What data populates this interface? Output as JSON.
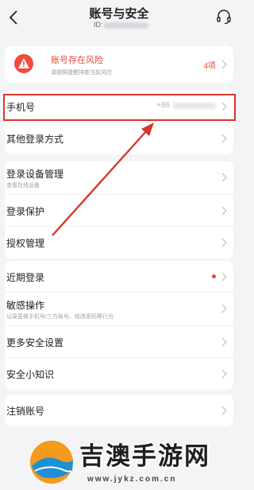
{
  "header": {
    "title": "账号与安全",
    "id_label": "ID:"
  },
  "risk_card": {
    "title": "账号存在风险",
    "subtitle": "请按照提醒排查当前风险",
    "count": "4项"
  },
  "phone_row": {
    "label": "手机号",
    "value": "+86"
  },
  "other_login": {
    "label": "其他登录方式"
  },
  "device_group": [
    {
      "label": "登录设备管理",
      "sub": "查看在线设备"
    },
    {
      "label": "登录保护"
    },
    {
      "label": "授权管理"
    }
  ],
  "security_group": [
    {
      "label": "近期登录"
    },
    {
      "label": "敏感操作",
      "sub": "记录更换手机号/三方账号、修改密码等行为"
    },
    {
      "label": "更多安全设置"
    },
    {
      "label": "安全小知识"
    }
  ],
  "cancel_account": {
    "label": "注销账号"
  },
  "watermark": {
    "title": "吉澳手游网",
    "url": "www.jykz.com.cn"
  },
  "colors": {
    "accent_red": "#e94538",
    "annotation_red": "#d7362c",
    "background": "#f4f4f6"
  }
}
